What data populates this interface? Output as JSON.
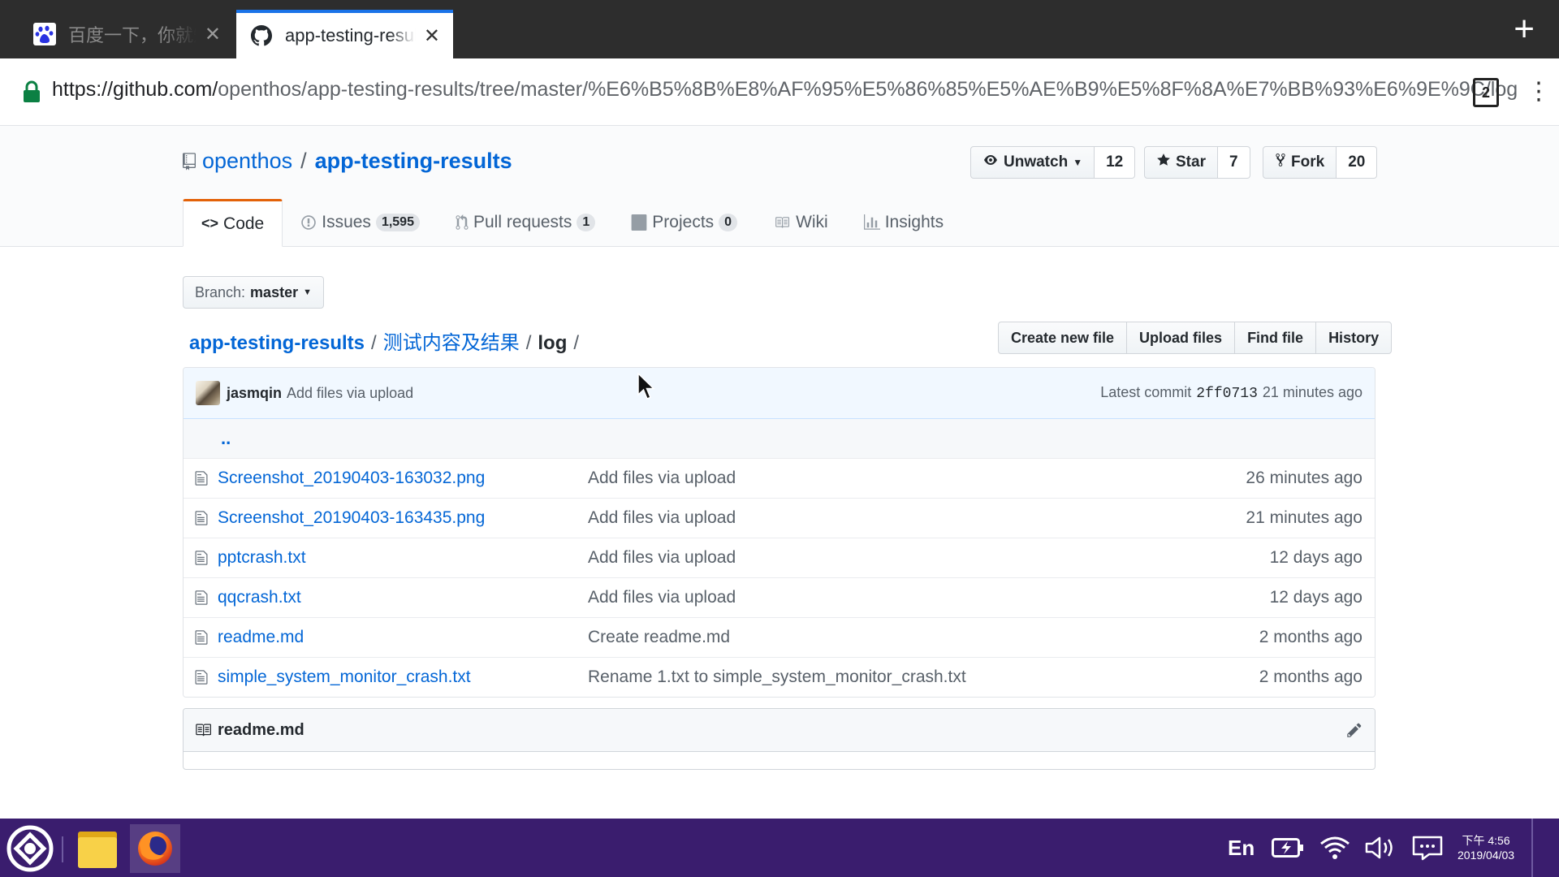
{
  "browser": {
    "tabs": [
      {
        "title": "百度一下，你就知道",
        "close": "✕",
        "active": false
      },
      {
        "title": "app-testing-results",
        "close": "✕",
        "active": true
      }
    ],
    "new_tab": "+",
    "url_host": "https://github.com/",
    "url_path": "openthos/app-testing-results/tree/master/%E6%B5%8B%E8%AF%95%E5%86%85%E5%AE%B9%E5%8F%8A%E7%BB%93%E6%9E%9C/log",
    "tab_count": "2",
    "menu": "⋮"
  },
  "repo": {
    "owner": "openthos",
    "separator": "/",
    "name": "app-testing-results",
    "watch_label": "Unwatch",
    "watch_count": "12",
    "star_label": "Star",
    "star_count": "7",
    "fork_label": "Fork",
    "fork_count": "20"
  },
  "nav": {
    "code": "Code",
    "issues": "Issues",
    "issues_count": "1,595",
    "pulls": "Pull requests",
    "pulls_count": "1",
    "projects": "Projects",
    "projects_count": "0",
    "wiki": "Wiki",
    "insights": "Insights"
  },
  "branch": {
    "label": "Branch:",
    "value": "master"
  },
  "breadcrumb": {
    "root": "app-testing-results",
    "dir": "测试内容及结果",
    "current": "log",
    "sep": "/"
  },
  "actions": {
    "create": "Create new file",
    "upload": "Upload files",
    "find": "Find file",
    "history": "History"
  },
  "commit": {
    "author": "jasmqin",
    "message": "Add files via upload",
    "latest_label": "Latest commit",
    "sha": "2ff0713",
    "age": "21 minutes ago"
  },
  "parent_dir": "..",
  "files": [
    {
      "name": "Screenshot_20190403-163032.png",
      "message": "Add files via upload",
      "age": "26 minutes ago"
    },
    {
      "name": "Screenshot_20190403-163435.png",
      "message": "Add files via upload",
      "age": "21 minutes ago"
    },
    {
      "name": "pptcrash.txt",
      "message": "Add files via upload",
      "age": "12 days ago"
    },
    {
      "name": "qqcrash.txt",
      "message": "Add files via upload",
      "age": "12 days ago"
    },
    {
      "name": "readme.md",
      "message": "Create readme.md",
      "age": "2 months ago"
    },
    {
      "name": "simple_system_monitor_crash.txt",
      "message": "Rename 1.txt to simple_system_monitor_crash.txt",
      "age": "2 months ago"
    }
  ],
  "readme": {
    "title": "readme.md"
  },
  "taskbar": {
    "lang": "En",
    "time": "下午 4:56",
    "date": "2019/04/03"
  },
  "colors": {
    "link": "#0366d6",
    "taskbar": "#3a1d6e",
    "tab_accent": "#e36209"
  }
}
